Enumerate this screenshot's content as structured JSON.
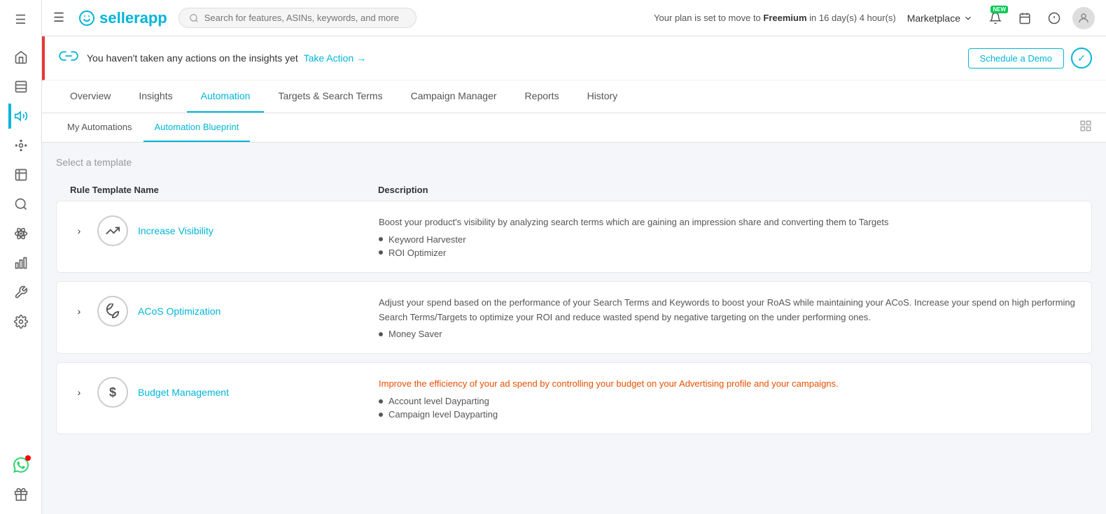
{
  "topbar": {
    "hamburger": "☰",
    "logo": "sellerapp",
    "search_placeholder": "Search for features, ASINs, keywords, and more",
    "plan_text": "Your plan is set to move to",
    "plan_name": "Freemium",
    "plan_time": "in 16 day(s) 4 hour(s)",
    "marketplace_label": "Marketplace"
  },
  "banner": {
    "text": "You haven't taken any actions on the insights yet",
    "action_text": "Take Action →",
    "schedule_label": "Schedule a Demo"
  },
  "tabs": [
    {
      "label": "Overview",
      "active": false
    },
    {
      "label": "Insights",
      "active": false
    },
    {
      "label": "Automation",
      "active": true
    },
    {
      "label": "Targets & Search Terms",
      "active": false
    },
    {
      "label": "Campaign Manager",
      "active": false
    },
    {
      "label": "Reports",
      "active": false
    },
    {
      "label": "History",
      "active": false
    }
  ],
  "sub_tabs": [
    {
      "label": "My Automations",
      "active": false
    },
    {
      "label": "Automation Blueprint",
      "active": true
    }
  ],
  "template_section": {
    "label": "Select a template",
    "col_rule_name": "Rule Template Name",
    "col_description": "Description",
    "templates": [
      {
        "name": "Increase Visibility",
        "icon": "📈",
        "description": "Boost your product's visibility by analyzing search terms which are gaining an impression share and converting them to Targets",
        "description_color": "normal",
        "bullets": [
          "Keyword Harvester",
          "ROI Optimizer"
        ]
      },
      {
        "name": "ACoS Optimization",
        "icon": "🌱",
        "description": "Adjust your spend based on the performance of your Search Terms and Keywords to boost your RoAS while maintaining your ACoS. Increase your spend on high performing Search Terms/Targets to optimize your ROI and reduce wasted spend by negative targeting on the under performing ones.",
        "description_color": "normal",
        "bullets": [
          "Money Saver"
        ]
      },
      {
        "name": "Budget Management",
        "icon": "$",
        "description": "Improve the efficiency of your ad spend by controlling your budget on your Advertising profile and your campaigns.",
        "description_color": "orange",
        "bullets": [
          "Account level Dayparting",
          "Campaign level Dayparting"
        ]
      }
    ]
  },
  "sidebar": {
    "icons": [
      {
        "name": "home-icon",
        "symbol": "🏠",
        "active": false
      },
      {
        "name": "dashboard-icon",
        "symbol": "▤",
        "active": false
      },
      {
        "name": "megaphone-icon",
        "symbol": "📣",
        "active": true
      },
      {
        "name": "target-icon",
        "symbol": "🎯",
        "active": false
      },
      {
        "name": "music-icon",
        "symbol": "🎸",
        "active": false
      },
      {
        "name": "search-icon",
        "symbol": "🔍",
        "active": false
      },
      {
        "name": "atom-icon",
        "symbol": "⚛",
        "active": false
      },
      {
        "name": "chart-icon",
        "symbol": "📊",
        "active": false
      },
      {
        "name": "tools-icon",
        "symbol": "🔧",
        "active": false
      },
      {
        "name": "settings-icon",
        "symbol": "⚙",
        "active": false
      }
    ],
    "bottom_icons": [
      {
        "name": "whatsapp-icon",
        "symbol": "💬"
      },
      {
        "name": "gift-icon",
        "symbol": "🎁"
      }
    ]
  }
}
